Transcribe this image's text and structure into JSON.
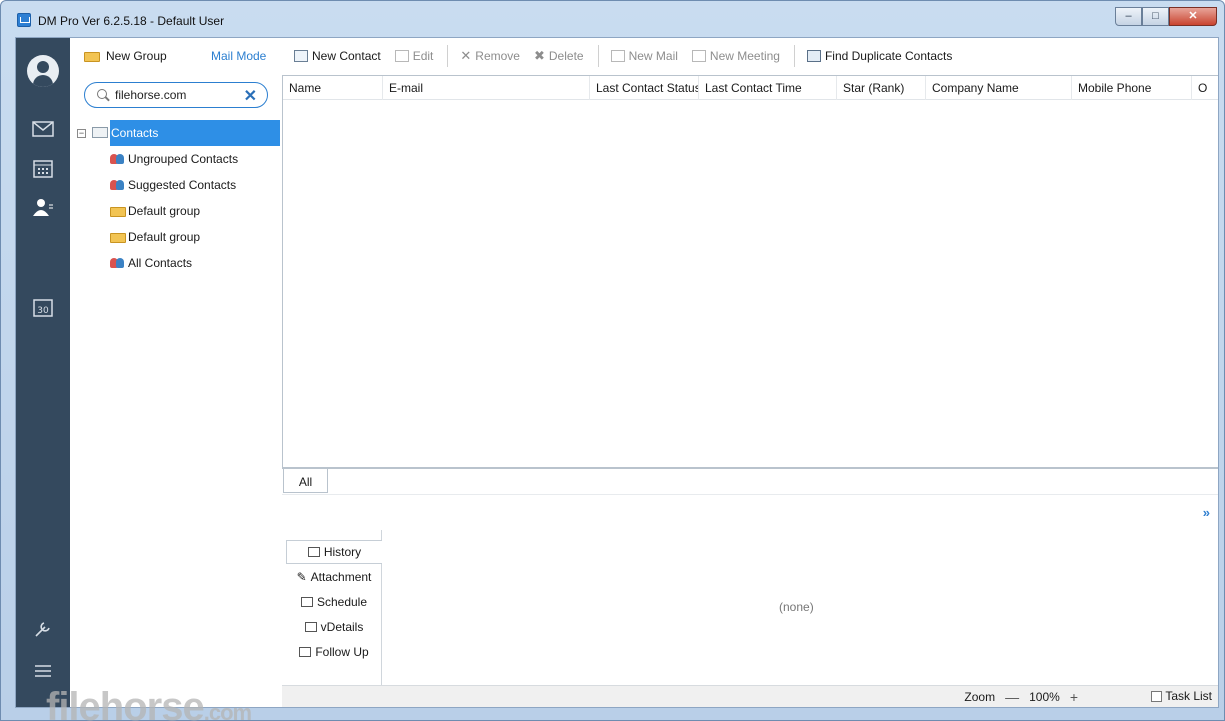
{
  "window": {
    "title": "DM Pro Ver 6.2.5.18  -  Default User",
    "controls": {
      "minimize": "–",
      "maximize": "□",
      "close": "✕"
    }
  },
  "sidebar_rail": {
    "icons": [
      "avatar-icon",
      "mail-icon",
      "calendar-icon",
      "contacts-icon",
      "date-30-icon",
      "wrench-icon",
      "menu-icon"
    ]
  },
  "folders": {
    "new_group": "New Group",
    "mail_mode": "Mail Mode",
    "search": {
      "value": "filehorse.com",
      "clear": "✕"
    },
    "tree": {
      "root": "Contacts",
      "items": [
        "Ungrouped Contacts",
        "Suggested Contacts",
        "Default group",
        "Default group",
        "All Contacts"
      ]
    }
  },
  "toolbar": {
    "new_contact": "New Contact",
    "edit": "Edit",
    "remove": "Remove",
    "delete": "Delete",
    "new_mail": "New Mail",
    "new_meeting": "New Meeting",
    "find_duplicates": "Find Duplicate Contacts"
  },
  "grid": {
    "columns": [
      "Name",
      "E-mail",
      "Last Contact Status",
      "Last Contact Time",
      "Star (Rank)",
      "Company Name",
      "Mobile Phone",
      "O"
    ]
  },
  "tabs": {
    "all": "All"
  },
  "detail": {
    "tabs": [
      "History",
      "Attachment",
      "Schedule",
      "vDetails",
      "Follow Up"
    ],
    "empty": "(none)",
    "collapse": "»"
  },
  "status": {
    "zoom_label": "Zoom",
    "zoom_minus": "—",
    "zoom_value": "100%",
    "zoom_plus": "+",
    "task_list": "Task List"
  },
  "watermark": {
    "main": "filehorse",
    "suffix": ".com"
  },
  "colors": {
    "rail": "#34495e",
    "selection": "#2e8fe6",
    "accent": "#2c7fd0"
  }
}
